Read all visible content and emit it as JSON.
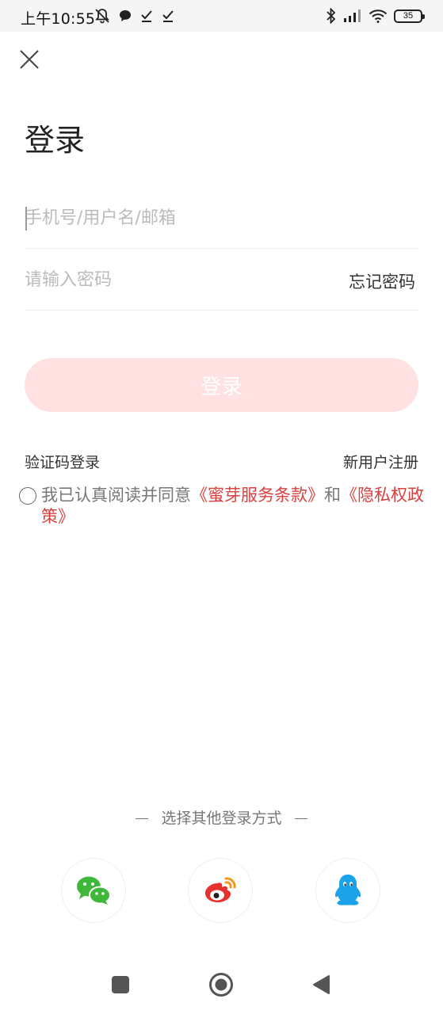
{
  "status_bar": {
    "time": "上午10:55",
    "battery": "35",
    "icons_left": [
      "mute-bell-icon",
      "chat-icon",
      "check-icon",
      "check-icon"
    ],
    "icons_right": [
      "bluetooth-icon",
      "signal-icon",
      "wifi-icon",
      "battery-icon"
    ]
  },
  "header": {
    "close_icon": "close-icon"
  },
  "title": "登录",
  "form": {
    "account_placeholder": "手机号/用户名/邮箱",
    "password_placeholder": "请输入密码",
    "forgot_label": "忘记密码",
    "login_button": "登录"
  },
  "links": {
    "sms_login": "验证码登录",
    "register": "新用户注册"
  },
  "agreement": {
    "prefix": "我已认真阅读并同意",
    "terms": "《蜜芽服务条款》",
    "and": "和",
    "privacy": "《隐私权政策》"
  },
  "other_login": {
    "title": "选择其他登录方式",
    "options": [
      "wechat-icon",
      "weibo-icon",
      "qq-icon"
    ]
  },
  "colors": {
    "accent": "#d9413f",
    "button_disabled": "#ffe1e1",
    "wechat": "#3fb83a",
    "weibo": "#e6312d",
    "qq": "#1aa3e8"
  }
}
